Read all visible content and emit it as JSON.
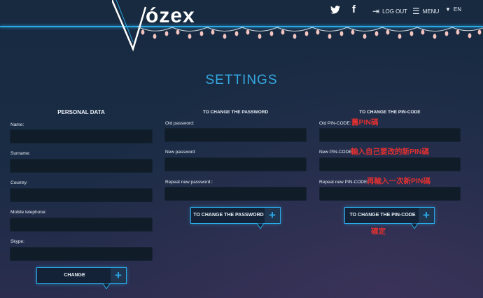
{
  "header": {
    "logo_text": "ózex",
    "nav": {
      "twitter_icon": "twitter-bird",
      "facebook_icon": "f",
      "logout": "LOG OUT",
      "menu": "MENU",
      "lang": "EN"
    }
  },
  "page_title": "SETTINGS",
  "personal": {
    "heading": "PERSONAL DATA",
    "name_label": "Name:",
    "surname_label": "Surname:",
    "country_label": "Country:",
    "mobile_label": "Mobile telephone:",
    "skype_label": "Skype:",
    "button": "CHANGE"
  },
  "password": {
    "heading": "TO CHANGE THE PASSWORD",
    "old_label": "Old password:",
    "new_label": "New password",
    "repeat_label": "Repeat new password::",
    "button": "TO CHANGE THE PASSWORD"
  },
  "pincode": {
    "heading": "TO CHANGE THE PIN-CODE",
    "old_label": "Old PIN-CODE:",
    "new_label": "New PIN-CODE:",
    "repeat_label": "Repeat new PIN-CODE:",
    "button": "TO CHANGE THE PIN-CODE"
  },
  "annotations": {
    "old_pin": "舊PIN碼",
    "new_pin": "輸入自己要改的新PIN碼",
    "repeat_pin": "再輸入一次新PIN碼",
    "confirm": "確定"
  },
  "colors": {
    "accent": "#2aa8e6",
    "annotation": "#e03030",
    "field": "#101c28"
  }
}
